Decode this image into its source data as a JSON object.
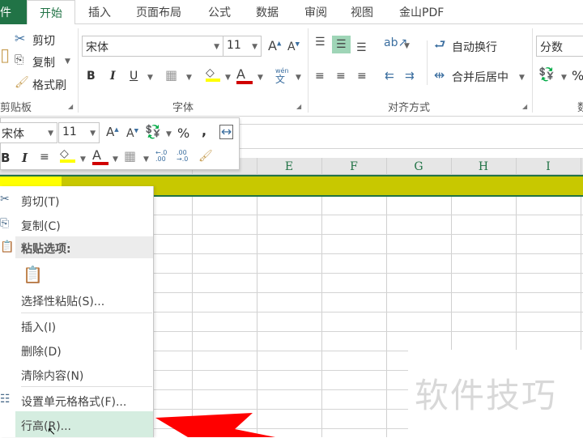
{
  "tabs": {
    "file": "件",
    "items": [
      "开始",
      "插入",
      "页面布局",
      "公式",
      "数据",
      "审阅",
      "视图",
      "金山PDF"
    ]
  },
  "ribbon": {
    "clipboard": {
      "paste": "占",
      "cut": "剪切",
      "copy": "复制",
      "format_painter": "格式刷",
      "label": "剪贴板"
    },
    "font": {
      "name": "宋体",
      "size": "11",
      "bold": "B",
      "italic": "I",
      "underline": "U",
      "font_color": "A",
      "phonetic": "wén",
      "label": "字体"
    },
    "alignment": {
      "wrap": "自动换行",
      "merge": "合并后居中",
      "label": "对齐方式"
    },
    "number": {
      "format": "分数",
      "percent": "%",
      "label": "数"
    }
  },
  "mini_toolbar": {
    "font": "宋体",
    "size": "11",
    "percent": "%",
    "comma": ",",
    "bold": "B",
    "italic": "I",
    "font_color": "A",
    "inc_dec": "←.0 .00",
    "dec_dec": ".00 →.0"
  },
  "columns": [
    "E",
    "F",
    "G",
    "H",
    "I"
  ],
  "context_menu": {
    "items": [
      {
        "label": "剪切(T)"
      },
      {
        "label": "复制(C)"
      },
      {
        "label": "粘贴选项:"
      },
      {
        "label": "选择性粘贴(S)..."
      },
      {
        "label": "插入(I)"
      },
      {
        "label": "删除(D)"
      },
      {
        "label": "清除内容(N)"
      },
      {
        "label": "设置单元格格式(F)..."
      },
      {
        "label": "行高(R)..."
      }
    ]
  },
  "watermark": "软件技巧",
  "colors": {
    "accent": "#217346",
    "band": "#c8c800",
    "highlight": "#d5ede0",
    "arrow": "#ff0000"
  }
}
